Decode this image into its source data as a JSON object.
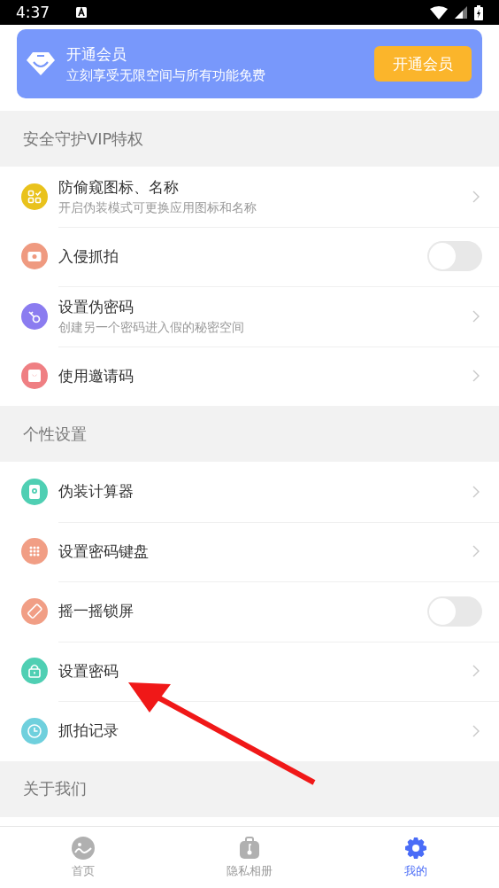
{
  "status_bar": {
    "time": "4:37"
  },
  "vip_banner": {
    "title": "开通会员",
    "subtitle": "立刻享受无限空间与所有功能免费",
    "button": "开通会员"
  },
  "sections": [
    {
      "title": "安全守护VIP特权",
      "items": [
        {
          "kind": "link",
          "title": "防偷窥图标、名称",
          "subtitle": "开启伪装模式可更换应用图标和名称",
          "color": "#e9c21c"
        },
        {
          "kind": "switch",
          "title": "入侵抓拍",
          "on": false,
          "color": "#ef9a80"
        },
        {
          "kind": "link",
          "title": "设置伪密码",
          "subtitle": "创建另一个密码进入假的秘密空间",
          "color": "#8b7cf0"
        },
        {
          "kind": "link",
          "title": "使用邀请码",
          "color": "#ef7f83"
        }
      ]
    },
    {
      "title": "个性设置",
      "items": [
        {
          "kind": "link",
          "title": "伪装计算器",
          "color": "#4fcfb3"
        },
        {
          "kind": "link",
          "title": "设置密码键盘",
          "color": "#f19e85"
        },
        {
          "kind": "switch",
          "title": "摇一摇锁屏",
          "on": false,
          "color": "#f19e85"
        },
        {
          "kind": "link",
          "title": "设置密码",
          "color": "#4fcfb3"
        },
        {
          "kind": "link",
          "title": "抓拍记录",
          "color": "#6fd0dd"
        }
      ]
    },
    {
      "title": "关于我们"
    }
  ],
  "bottom_nav": [
    {
      "label": "首页",
      "selected": false
    },
    {
      "label": "隐私相册",
      "selected": false
    },
    {
      "label": "我的",
      "selected": true
    }
  ]
}
